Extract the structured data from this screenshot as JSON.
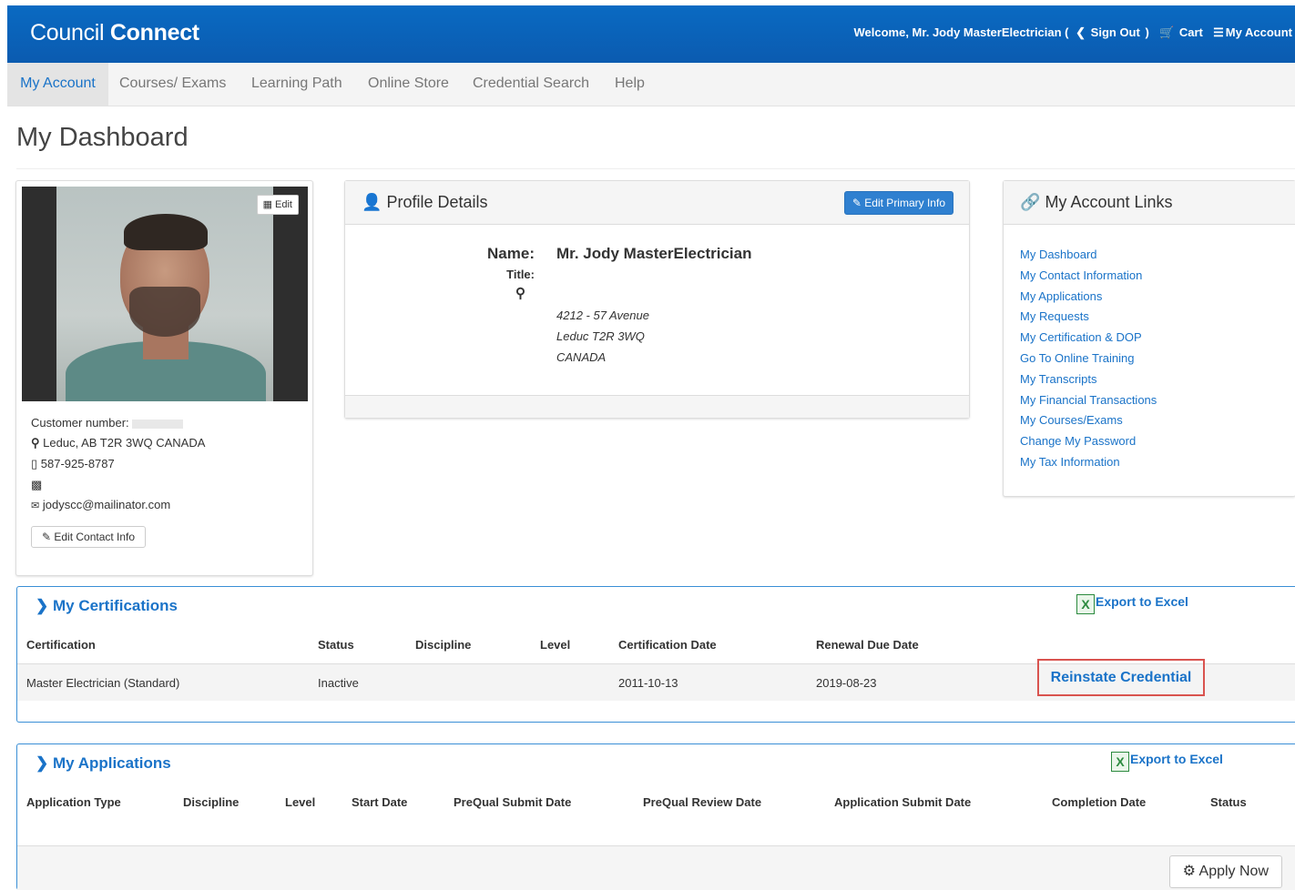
{
  "header": {
    "logo_light": "Council ",
    "logo_bold": "Connect",
    "welcome": "Welcome, Mr. Jody MasterElectrician (",
    "sign_out": "Sign Out",
    "welcome_close": ")",
    "cart": "Cart",
    "my_account": "My Account"
  },
  "nav": {
    "items": [
      "My Account",
      "Courses/ Exams",
      "Learning Path",
      "Online Store",
      "Credential Search",
      "Help"
    ],
    "active": "My Account"
  },
  "page_title": "My Dashboard",
  "contact_card": {
    "photo_edit": "Edit",
    "customer_number_label": "Customer number:",
    "location": "Leduc, AB T2R 3WQ CANADA",
    "phone": "587-925-8787",
    "email": "jodyscc@mailinator.com",
    "edit_contact": "Edit Contact Info"
  },
  "profile": {
    "title": "Profile Details",
    "edit_btn": "Edit Primary Info",
    "name_label": "Name:",
    "name": "Mr. Jody MasterElectrician",
    "title_label": "Title:",
    "address": [
      "4212 - 57 Avenue",
      "Leduc T2R 3WQ",
      "CANADA"
    ]
  },
  "account_links": {
    "title": "My Account Links",
    "links": [
      "My Dashboard",
      "My Contact Information",
      "My Applications",
      "My Requests",
      "My Certification & DOP",
      "Go To Online Training",
      "My Transcripts",
      "My Financial Transactions",
      "My Courses/Exams",
      "Change My Password",
      "My Tax Information"
    ]
  },
  "certifications": {
    "title": "My Certifications",
    "export": "Export to Excel",
    "columns": [
      "Certification",
      "Status",
      "Discipline",
      "Level",
      "Certification Date",
      "Renewal Due Date"
    ],
    "rows": [
      {
        "certification": "Master Electrician (Standard)",
        "status": "Inactive",
        "discipline": "",
        "level": "",
        "cert_date": "2011-10-13",
        "renewal_date": "2019-08-23",
        "action": "Reinstate Credential"
      }
    ]
  },
  "applications": {
    "title": "My Applications",
    "export": "Export to Excel",
    "columns": [
      "Application Type",
      "Discipline",
      "Level",
      "Start Date",
      "PreQual Submit Date",
      "PreQual Review Date",
      "Application Submit Date",
      "Completion Date",
      "Status"
    ],
    "apply_now": "Apply Now"
  },
  "colors": {
    "brand_blue": "#0b5bb0",
    "link_blue": "#1a73c8",
    "highlight_red": "#d9534f",
    "excel_green": "#2b8a3e"
  }
}
